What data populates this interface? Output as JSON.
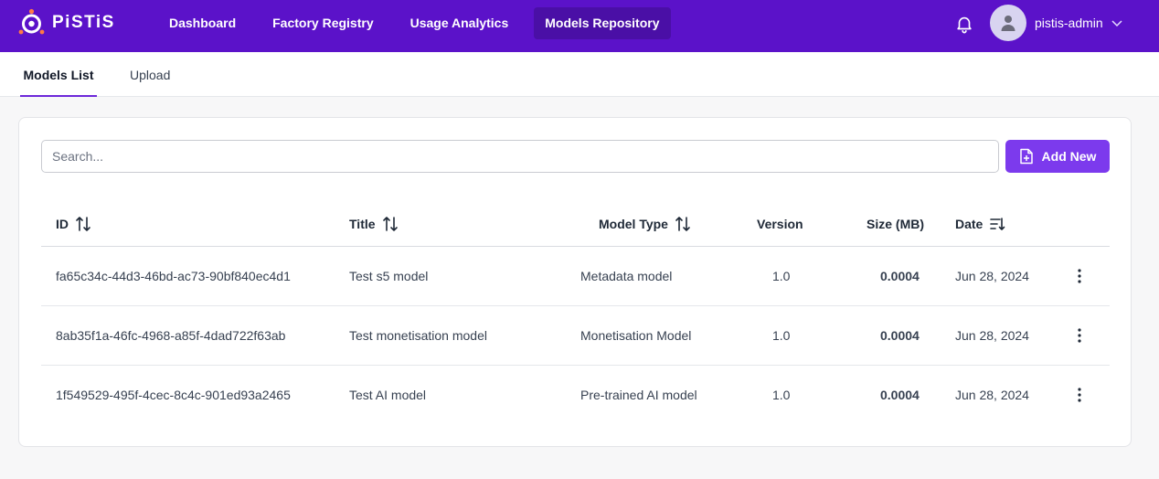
{
  "brand": {
    "name": "PiSTiS"
  },
  "nav": {
    "items": [
      {
        "label": "Dashboard"
      },
      {
        "label": "Factory Registry"
      },
      {
        "label": "Usage Analytics"
      },
      {
        "label": "Models Repository"
      }
    ]
  },
  "user": {
    "name": "pistis-admin"
  },
  "tabs": [
    {
      "label": "Models List"
    },
    {
      "label": "Upload"
    }
  ],
  "search": {
    "placeholder": "Search...",
    "value": ""
  },
  "add_button": {
    "label": "Add New"
  },
  "table": {
    "columns": [
      "ID",
      "Title",
      "Model Type",
      "Version",
      "Size (MB)",
      "Date"
    ],
    "rows": [
      {
        "id": "fa65c34c-44d3-46bd-ac73-90bf840ec4d1",
        "title": "Test s5 model",
        "type": "Metadata model",
        "version": "1.0",
        "size": "0.0004",
        "date": "Jun 28, 2024"
      },
      {
        "id": "8ab35f1a-46fc-4968-a85f-4dad722f63ab",
        "title": "Test monetisation model",
        "type": "Monetisation Model",
        "version": "1.0",
        "size": "0.0004",
        "date": "Jun 28, 2024"
      },
      {
        "id": "1f549529-495f-4cec-8c4c-901ed93a2465",
        "title": "Test AI model",
        "type": "Pre-trained AI model",
        "version": "1.0",
        "size": "0.0004",
        "date": "Jun 28, 2024"
      }
    ]
  },
  "colors": {
    "header": "#5b12c9",
    "accent": "#7c3aed",
    "active_nav": "#4a0fa6"
  }
}
